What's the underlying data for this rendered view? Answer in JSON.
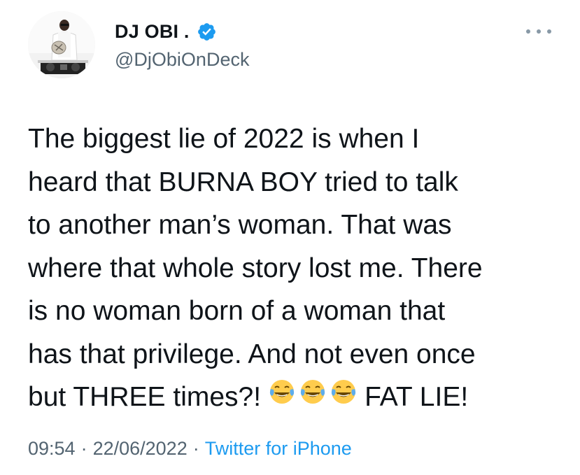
{
  "author": {
    "display_name": "DJ OBI .",
    "username": "@DjObiOnDeck",
    "verified": true,
    "verified_color": "#1d9bf0"
  },
  "tweet": {
    "lines": [
      "The biggest lie of 2022 is when I",
      "heard that BURNA BOY tried to talk",
      "to another man’s woman. That was",
      "where that whole story lost me. There",
      "is no woman born of a woman that",
      "has that privilege. And not even once"
    ],
    "last_line_prefix": "but THREE times?!",
    "last_line_emojis": [
      "face-with-tears-of-joy-icon",
      "face-with-tears-of-joy-icon",
      "face-with-tears-of-joy-icon"
    ],
    "last_line_suffix": "FAT LIE!"
  },
  "meta": {
    "time": "09:54",
    "date": "22/06/2022",
    "separator": "·",
    "source": "Twitter for iPhone"
  },
  "icons": {
    "more": "more-horizontal-icon",
    "verified": "verified-badge-icon"
  },
  "colors": {
    "text": "#0f1419",
    "secondary": "#536471",
    "link": "#1d9bf0"
  }
}
